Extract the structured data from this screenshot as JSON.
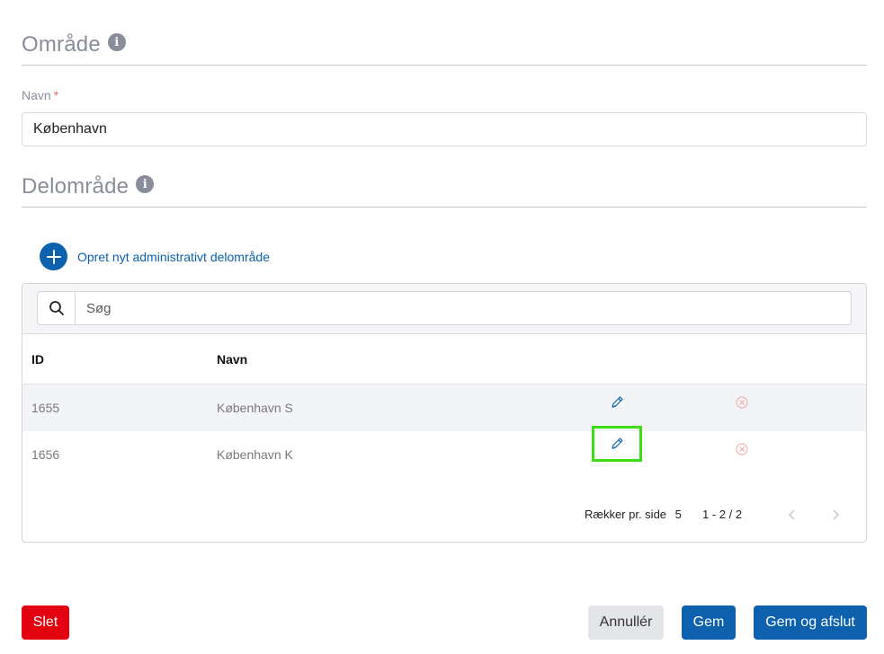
{
  "area_section": {
    "title": "Område",
    "info_icon": "info-icon"
  },
  "name_field": {
    "label": "Navn",
    "required_mark": "*",
    "value": "København"
  },
  "subarea_section": {
    "title": "Delområde",
    "info_icon": "info-icon"
  },
  "create_subarea": {
    "label": "Opret nyt administrativt delområde",
    "icon": "plus-icon"
  },
  "search": {
    "placeholder": "Søg",
    "icon": "search-icon"
  },
  "table": {
    "headers": {
      "id": "ID",
      "name": "Navn"
    },
    "rows": [
      {
        "id": "1655",
        "name": "København S"
      },
      {
        "id": "1656",
        "name": "København K"
      }
    ]
  },
  "pagination": {
    "rows_per_page_label": "Rækker pr. side",
    "rows_per_page_value": "5",
    "range": "1 - 2 / 2"
  },
  "actions": {
    "delete": "Slet",
    "cancel": "Annullér",
    "save": "Gem",
    "save_close": "Gem og afslut"
  },
  "colors": {
    "primary": "#0d61ad",
    "danger": "#e3000f",
    "highlight": "#3ddc17"
  }
}
